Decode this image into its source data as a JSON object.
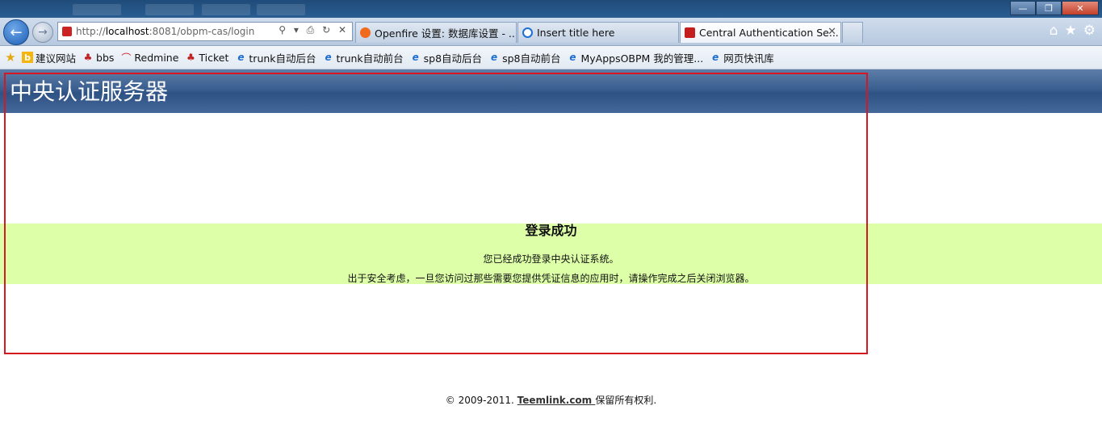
{
  "window": {
    "minimize": "—",
    "restore": "❐",
    "close": "✕"
  },
  "nav": {
    "back_icon": "←",
    "forward_icon": "→",
    "url_scheme": "http://",
    "url_host": "localhost",
    "url_path": ":8081/obpm-cas/login",
    "address_tools": "⚲ ▾ ⎙ ↻ ✕"
  },
  "tabs": [
    {
      "label": "Openfire 设置: 数据库设置 - ...",
      "icon": "openfire-icon",
      "color": "#f26a1b"
    },
    {
      "label": "Insert title here",
      "icon": "ie-icon",
      "color": "#1d6fd1"
    },
    {
      "label": "Central Authentication Se...",
      "icon": "cas-icon",
      "color": "#c31f1f",
      "close": "✕"
    }
  ],
  "toolbar_icons": {
    "home": "⌂",
    "favorites": "★",
    "tools": "⚙"
  },
  "favorites": [
    {
      "label": "建议网站",
      "icon": "bing-icon"
    },
    {
      "label": "bbs",
      "icon": "cas-icon"
    },
    {
      "label": "Redmine",
      "icon": "redmine-icon"
    },
    {
      "label": "Ticket",
      "icon": "cas-icon"
    },
    {
      "label": "trunk自动后台",
      "icon": "ie-icon"
    },
    {
      "label": "trunk自动前台",
      "icon": "ie-icon"
    },
    {
      "label": "sp8自动后台",
      "icon": "ie-icon"
    },
    {
      "label": "sp8自动前台",
      "icon": "ie-icon"
    },
    {
      "label": "MyAppsOBPM 我的管理...",
      "icon": "ie-icon"
    },
    {
      "label": "网页快讯库",
      "icon": "ie-icon"
    }
  ],
  "page": {
    "title": "中央认证服务器",
    "success_heading": "登录成功",
    "success_msg": "您已经成功登录中央认证系统。",
    "security_msg": "出于安全考虑，一旦您访问过那些需要您提供凭证信息的应用时，请操作完成之后关闭浏览器。",
    "footer_prefix": "© 2009-2011. ",
    "footer_link": "Teemlink.com ",
    "footer_suffix": "保留所有权利."
  },
  "colors": {
    "header": "#3a5e8f",
    "success_bg": "#dcffa8",
    "highlight_box": "#d51822"
  }
}
